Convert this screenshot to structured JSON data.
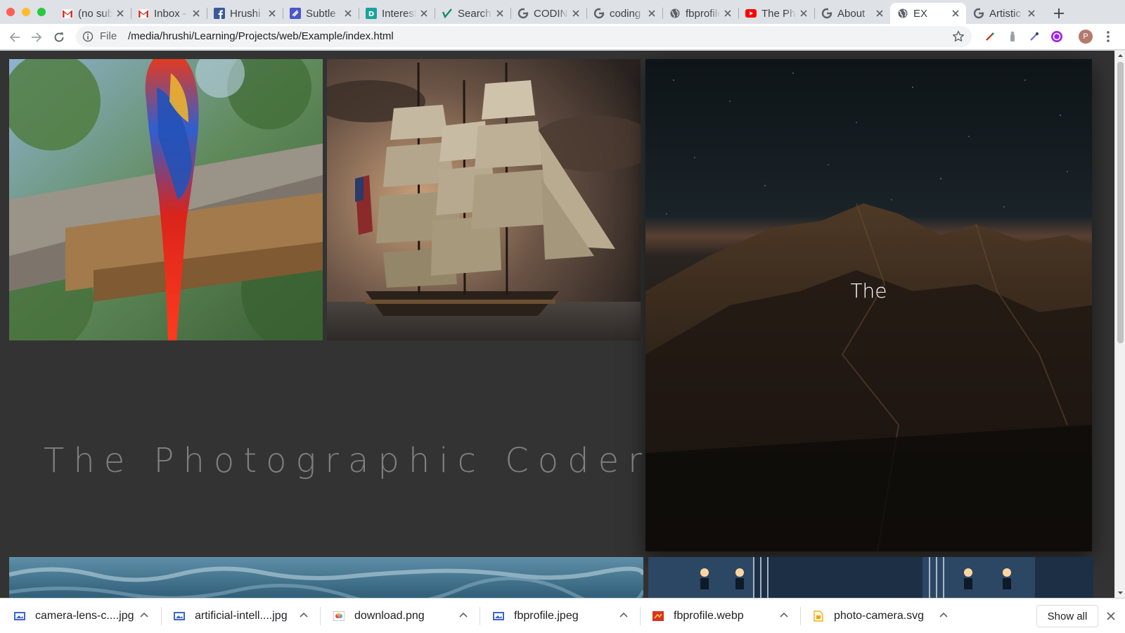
{
  "browser": {
    "tabs": [
      {
        "title": "(no subject)",
        "favicon": "gmail-icon"
      },
      {
        "title": "Inbox - ",
        "favicon": "gmail-icon"
      },
      {
        "title": "Hrushi",
        "favicon": "facebook-icon"
      },
      {
        "title": "Subtle",
        "favicon": "ghost-icon"
      },
      {
        "title": "Interest",
        "favicon": "dribbble-icon"
      },
      {
        "title": "Search",
        "favicon": "vimeo-icon"
      },
      {
        "title": "CODING",
        "favicon": "google-icon"
      },
      {
        "title": "coding",
        "favicon": "google-icon"
      },
      {
        "title": "fbprofile",
        "favicon": "globe-icon"
      },
      {
        "title": "The Ph",
        "favicon": "youtube-icon"
      },
      {
        "title": "About",
        "favicon": "google-icon"
      },
      {
        "title": "EX",
        "favicon": "globe-icon",
        "active": true
      },
      {
        "title": "Artistic",
        "favicon": "google-icon"
      }
    ],
    "omnibox": {
      "scheme_label": "File",
      "url": "/media/hrushi/Learning/Projects/web/Example/index.html"
    },
    "profile_initial": "P"
  },
  "page": {
    "hero_title": "The Photographic Coder",
    "mountain_caption": "The",
    "images": {
      "parrot": "parrot-photo",
      "ship": "tall-ship-photo",
      "mountain": "night-mountain-photo",
      "water": "ocean-photo",
      "hall": "corridor-photo"
    }
  },
  "downloads": {
    "items": [
      {
        "name": "camera-lens-c....jpg",
        "icon": "image-file-icon"
      },
      {
        "name": "artificial-intell....jpg",
        "icon": "image-file-icon"
      },
      {
        "name": "download.png",
        "icon": "png-file-icon"
      },
      {
        "name": "fbprofile.jpeg",
        "icon": "image-file-icon"
      },
      {
        "name": "fbprofile.webp",
        "icon": "webp-file-icon"
      },
      {
        "name": "photo-camera.svg",
        "icon": "svg-file-icon"
      }
    ],
    "show_all_label": "Show all"
  },
  "colors": {
    "page_background": "#333333",
    "hero_text": "#7f7f7f",
    "tabstrip": "#dee1e6"
  }
}
